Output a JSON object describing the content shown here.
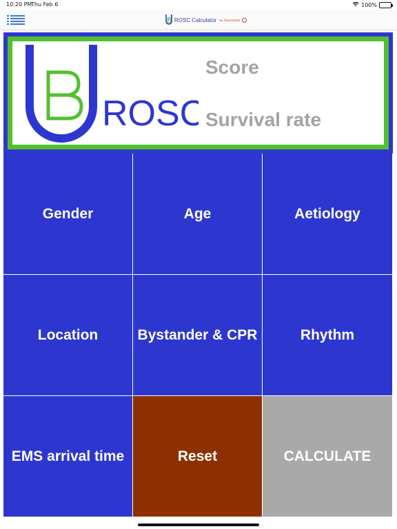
{
  "status_bar": {
    "time": "10:20 PM",
    "date": "Thu Feb 6",
    "battery": "100%"
  },
  "nav": {
    "app_name": "ROSC Calculator",
    "by": "by",
    "brand": "Resuscitate",
    "menu_icon": "list-menu-icon"
  },
  "header": {
    "logo_letters": "ROSC",
    "logo_u": "U",
    "logo_b": "B",
    "score_label": "Score",
    "survival_label": "Survival rate"
  },
  "buttons": [
    {
      "label": "Gender"
    },
    {
      "label": "Age"
    },
    {
      "label": "Aetiology"
    },
    {
      "label": "Location"
    },
    {
      "label": "Bystander & CPR"
    },
    {
      "label": "Rhythm"
    },
    {
      "label": "EMS arrival time"
    },
    {
      "label": "Reset"
    },
    {
      "label": "CALCULATE"
    }
  ],
  "colors": {
    "primary_blue": "#2d37d0",
    "logo_green": "#52c02f",
    "reset_brown": "#8e3102",
    "calculate_gray": "#a9a9a9",
    "label_gray": "#a3a3a3"
  }
}
